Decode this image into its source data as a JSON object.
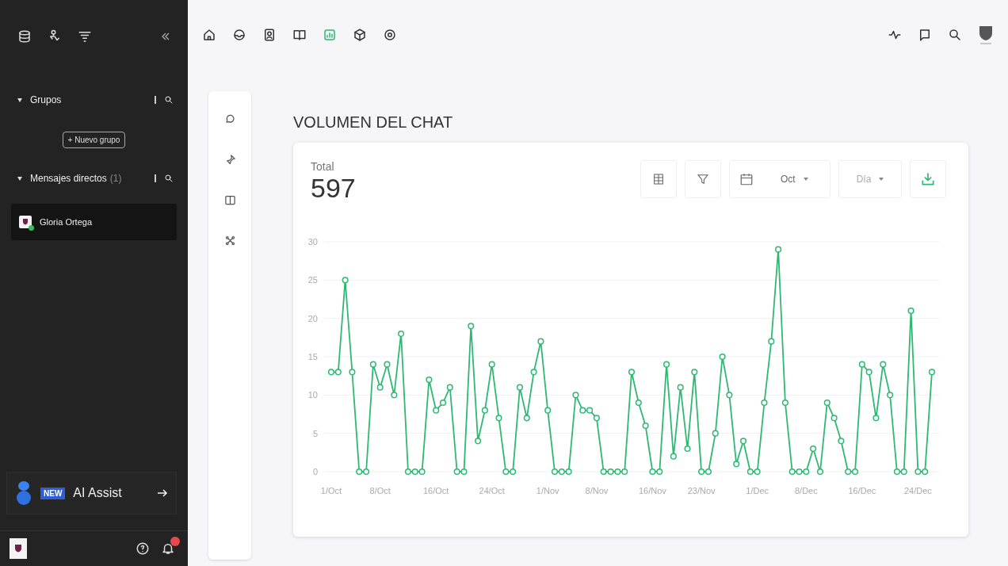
{
  "sidebar": {
    "top_icons": [
      {
        "selected": false
      },
      {
        "selected": false
      },
      {
        "selected": false
      }
    ],
    "sections": [
      {
        "title": "Grupos",
        "expanded": true,
        "button": "+ Nuevo grupo"
      },
      {
        "title": "Mensajes directos",
        "count": "(1)",
        "expanded": true,
        "items": [
          {
            "name": "Gloria Ortega",
            "selected": true,
            "online": true
          }
        ]
      }
    ],
    "ai_assist": {
      "badge": "NEW",
      "label": "AI Assist"
    }
  },
  "top_nav": {
    "items": [
      {
        "selected": false
      },
      {
        "selected": false
      },
      {
        "selected": false
      },
      {
        "selected": false
      },
      {
        "selected": true
      },
      {
        "selected": false
      },
      {
        "selected": false
      }
    ]
  },
  "side_tools": [
    {
      "selected": false
    },
    {
      "selected": false
    },
    {
      "selected": false
    },
    {
      "selected": false
    }
  ],
  "page_title": "VOLUMEN DEL CHAT",
  "card": {
    "total_label": "Total",
    "total": "597",
    "month_select": "Oct",
    "period_select": "Día",
    "chart_data": {
      "type": "line",
      "ylim": [
        0,
        30
      ],
      "yticks": [
        0,
        5,
        10,
        15,
        20,
        25,
        30
      ],
      "grid": true,
      "categories": [
        "1/Oct",
        null,
        null,
        null,
        null,
        null,
        null,
        "8/Oct",
        null,
        null,
        null,
        null,
        null,
        null,
        null,
        "16/Oct",
        null,
        null,
        null,
        null,
        null,
        null,
        null,
        "24/Oct",
        null,
        null,
        null,
        null,
        null,
        null,
        null,
        "1/Nov",
        null,
        null,
        null,
        null,
        null,
        null,
        "8/Nov",
        null,
        null,
        null,
        null,
        null,
        null,
        null,
        "16/Nov",
        null,
        null,
        null,
        null,
        null,
        null,
        "23/Nov",
        null,
        null,
        null,
        null,
        null,
        null,
        null,
        "1/Dec",
        null,
        null,
        null,
        null,
        null,
        null,
        "8/Dec",
        null,
        null,
        null,
        null,
        null,
        null,
        null,
        "16/Dec",
        null,
        null,
        null,
        null,
        null,
        null,
        null,
        "24/Dec",
        null,
        null
      ],
      "series": [
        {
          "color": "#2eb872",
          "marker": "circle",
          "values": [
            13,
            13,
            25,
            13,
            0,
            0,
            14,
            11,
            14,
            10,
            18,
            0,
            0,
            0,
            12,
            8,
            9,
            11,
            0,
            0,
            19,
            4,
            8,
            14,
            7,
            0,
            0,
            11,
            7,
            13,
            17,
            8,
            0,
            0,
            0,
            10,
            8,
            8,
            7,
            0,
            0,
            0,
            0,
            13,
            9,
            6,
            0,
            0,
            14,
            2,
            11,
            3,
            13,
            0,
            0,
            5,
            15,
            10,
            1,
            4,
            0,
            0,
            9,
            17,
            29,
            9,
            0,
            0,
            0,
            3,
            0,
            9,
            7,
            4,
            0,
            0,
            14,
            13,
            7,
            14,
            10,
            0,
            0,
            21,
            0,
            0,
            13
          ]
        }
      ]
    }
  }
}
